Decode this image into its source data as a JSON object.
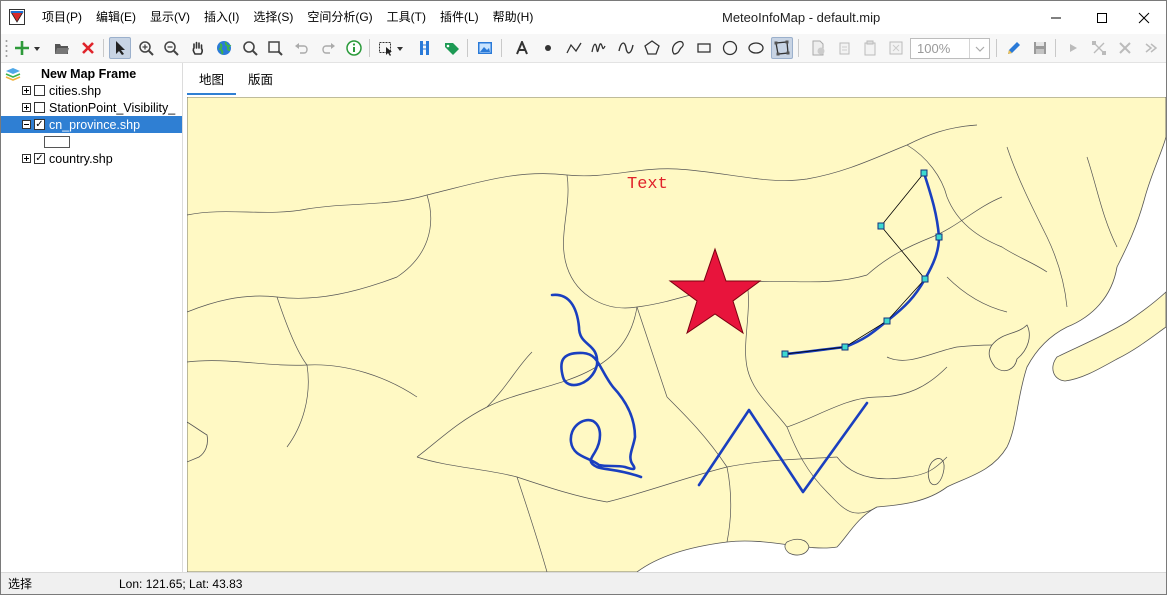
{
  "window": {
    "title": "MeteoInfoMap - default.mip"
  },
  "menu": [
    "项目(P)",
    "编辑(E)",
    "显示(V)",
    "插入(I)",
    "选择(S)",
    "空间分析(G)",
    "工具(T)",
    "插件(L)",
    "帮助(H)"
  ],
  "toolbar": {
    "zoom_value": "100%",
    "icons": [
      "add-layer-icon",
      "open-folder-icon",
      "remove-layer-icon",
      "select-arrow-icon",
      "zoom-in-icon",
      "zoom-out-icon",
      "pan-hand-icon",
      "full-extent-globe-icon",
      "magnifier-icon",
      "zoom-to-rect-icon",
      "undo-icon",
      "redo-icon",
      "identify-info-icon",
      "select-feature-icon",
      "measure-icon",
      "label-tag-icon",
      "picture-icon",
      "text-a-icon",
      "point-icon",
      "polyline-icon",
      "freehand-curve-icon",
      "curve-icon",
      "polygon-icon",
      "freehand-polygon-icon",
      "rectangle-icon",
      "circle-icon",
      "ellipse-icon",
      "edit-vertices-icon",
      "new-layer-icon",
      "copy-icon",
      "paste-icon",
      "fit-icon",
      "pencil-edit-icon",
      "save-edit-icon",
      "play-icon",
      "edit-node-icon",
      "close-x-icon",
      "chevron-icon"
    ]
  },
  "tree": {
    "frame": "New Map Frame",
    "layers": [
      {
        "name": "cities.shp",
        "checked": false,
        "expanded": false
      },
      {
        "name": "StationPoint_Visibility_",
        "checked": false,
        "expanded": false
      },
      {
        "name": "cn_province.shp",
        "checked": true,
        "expanded": true,
        "selected": true
      },
      {
        "name": "country.shp",
        "checked": true,
        "expanded": false
      }
    ]
  },
  "tabs": [
    "地图",
    "版面"
  ],
  "map": {
    "text_label": "Text",
    "colors": {
      "land": "#fff9c4",
      "sea": "#ffffff",
      "boundary": "#555555",
      "graphic_line": "#1a3fbf",
      "star": "#e8143c",
      "text": "#e0222a"
    }
  },
  "status": {
    "mode": "选择",
    "coords": "Lon: 121.65; Lat: 43.83"
  }
}
